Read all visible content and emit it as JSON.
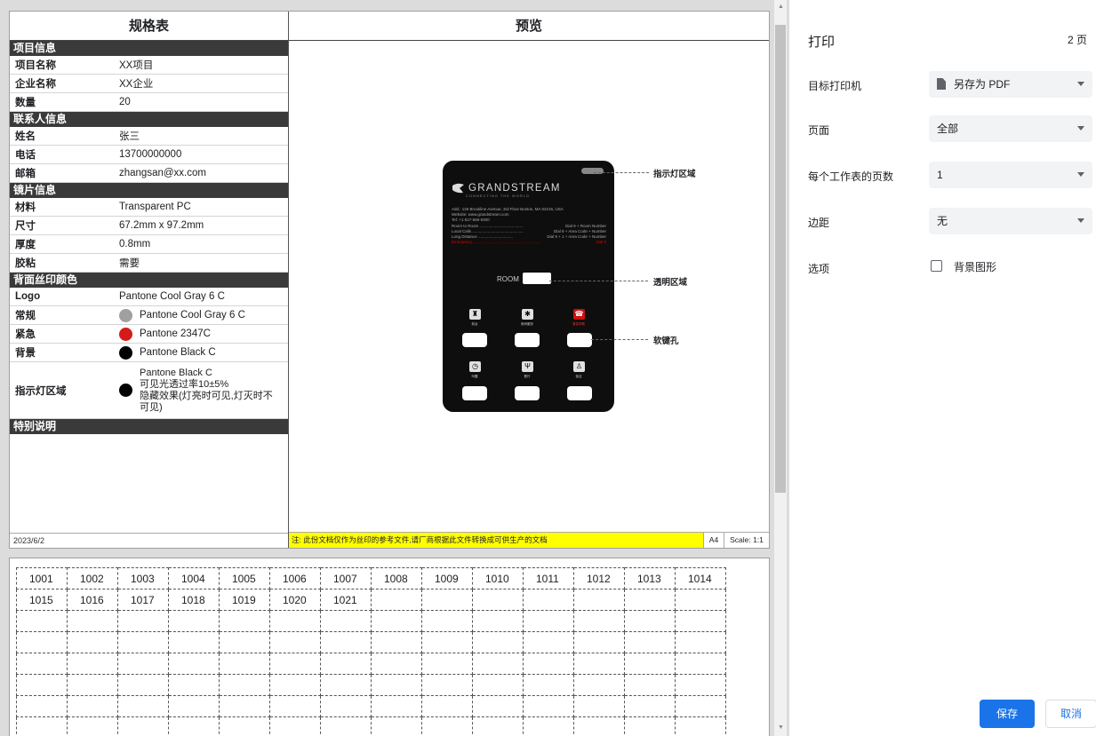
{
  "spec": {
    "title": "规格表",
    "sections": [
      {
        "title": "项目信息",
        "rows": [
          {
            "k": "项目名称",
            "v": "XX项目"
          },
          {
            "k": "企业名称",
            "v": "XX企业"
          },
          {
            "k": "数量",
            "v": "20"
          }
        ]
      },
      {
        "title": "联系人信息",
        "rows": [
          {
            "k": "姓名",
            "v": "张三"
          },
          {
            "k": "电话",
            "v": "13700000000"
          },
          {
            "k": "邮箱",
            "v": "zhangsan@xx.com"
          }
        ]
      },
      {
        "title": "镜片信息",
        "rows": [
          {
            "k": "材料",
            "v": "Transparent PC"
          },
          {
            "k": "尺寸",
            "v": "67.2mm x 97.2mm"
          },
          {
            "k": "厚度",
            "v": "0.8mm"
          },
          {
            "k": "胶粘",
            "v": "需要"
          }
        ]
      },
      {
        "title": "背面丝印颜色",
        "rows": []
      }
    ],
    "colors": {
      "logo": {
        "k": "Logo",
        "v": "Pantone Cool Gray 6 C"
      },
      "normal": {
        "k": "常规",
        "v": "Pantone Cool Gray 6 C",
        "swatch": "#a0a0a0"
      },
      "emergency": {
        "k": "紧急",
        "v": "Pantone 2347C",
        "swatch": "#d51a1a"
      },
      "background": {
        "k": "背景",
        "v": "Pantone Black C",
        "swatch": "#000000"
      },
      "indicator": {
        "k": "指示灯区域",
        "swatch": "#000000",
        "lines": [
          "Pantone Black C",
          "可见光透过率10±5%",
          "隐藏效果(灯亮时可见,灯灭时不",
          "可见)"
        ]
      }
    },
    "special_title": "特别说明",
    "date": "2023/6/2"
  },
  "preview": {
    "title": "预览",
    "note": "注: 此份文档仅作为丝印的参考文件,请厂商根据此文件转换成可供生产的文档",
    "paper": "A4",
    "scale": "Scale: 1:1",
    "card": {
      "brand": "GRANDSTREAM",
      "tagline": "CONNECTING THE WORLD",
      "address": "Add.: 126 Brookline Avenue, 3rd Floor Boston, MA 02215, USA",
      "website": "Website: www.grandstream.com",
      "tel": "Tel: +1 617-566-9300",
      "dial": [
        {
          "a": "Room to Room .......................................",
          "b": "Dial 9 + Room Number"
        },
        {
          "a": "Local Calls ..............................................",
          "b": "Dial 9 + Area Code + Number"
        },
        {
          "a": "Long Distance ...............................",
          "b": "Dial 9 + 1 + Area Code + Number"
        }
      ],
      "emergency": {
        "a": "Emergency..............................................................",
        "b": "Dial 9"
      },
      "room": "ROOM",
      "icons_row1": [
        {
          "label": "前台",
          "icon": "reception-icon"
        },
        {
          "label": "房间服务",
          "icon": "room-service-icon"
        },
        {
          "label": "紧急呼救",
          "icon": "emergency-phone-icon"
        }
      ],
      "icons_row2": [
        {
          "label": "叫醒",
          "icon": "alarm-clock-icon"
        },
        {
          "label": "餐厅",
          "icon": "restaurant-icon"
        },
        {
          "label": "保洁",
          "icon": "housekeeping-icon"
        }
      ]
    },
    "callouts": {
      "indicator": "指示灯区域",
      "transparent": "透明区域",
      "softkey": "软键孔"
    }
  },
  "grid": {
    "row1": [
      "1001",
      "1002",
      "1003",
      "1004",
      "1005",
      "1006",
      "1007",
      "1008",
      "1009",
      "1010",
      "1011",
      "1012",
      "1013",
      "1014"
    ],
    "row2": [
      "1015",
      "1016",
      "1017",
      "1018",
      "1019",
      "1020",
      "1021"
    ]
  },
  "settings": {
    "title": "打印",
    "pages": "2 页",
    "rows": [
      {
        "label": "目标打印机",
        "value": "另存为 PDF"
      },
      {
        "label": "页面",
        "value": "全部"
      },
      {
        "label": "每个工作表的页数",
        "value": "1"
      },
      {
        "label": "边距",
        "value": "无"
      }
    ],
    "options_label": "选项",
    "bg_graphics": "背景图形",
    "save": "保存",
    "cancel": "取消",
    "accent": "#1a73e8"
  }
}
